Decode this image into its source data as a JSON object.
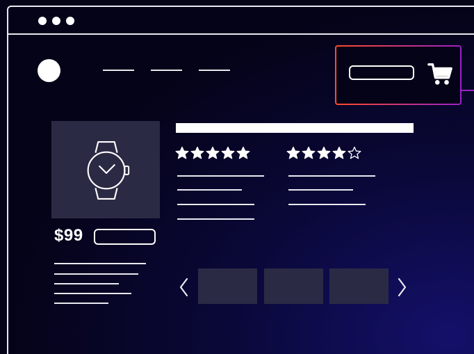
{
  "product": {
    "price": "$99"
  },
  "ratings": [
    {
      "stars": 5,
      "max": 5
    },
    {
      "stars": 4,
      "max": 5
    }
  ],
  "icons": {
    "cart": "shopping-cart-icon",
    "product": "wristwatch-icon",
    "prev": "chevron-left-icon",
    "next": "chevron-right-icon"
  },
  "colors": {
    "background": "#050317",
    "outline": "#e9e9f2",
    "panel": "#2b2a45",
    "highlight_start": "#ff4a2a",
    "highlight_end": "#9b22c8"
  }
}
